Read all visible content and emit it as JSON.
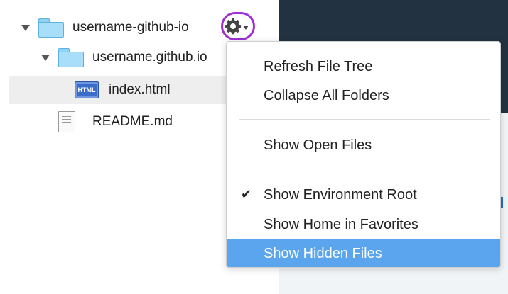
{
  "file_tree": {
    "root_folder": {
      "label": "username-github-io",
      "icon": "folder-icon"
    },
    "subfolder": {
      "label": "username.github.io",
      "icon": "folder-icon"
    },
    "files": [
      {
        "label": "index.html",
        "icon": "html-file-icon",
        "badge": "HTML",
        "selected": true
      },
      {
        "label": "README.md",
        "icon": "document-icon",
        "selected": false
      }
    ]
  },
  "toolbar": {
    "gear_icon": "gear-icon",
    "caret_icon": "chevron-down-icon"
  },
  "context_menu": {
    "items": [
      {
        "label": "Refresh File Tree"
      },
      {
        "label": "Collapse All Folders"
      },
      {
        "label": "Show Open Files"
      },
      {
        "label": "Show Environment Root",
        "checked": true
      },
      {
        "label": "Show Home in Favorites"
      },
      {
        "label": "Show Hidden Files",
        "highlighted": true
      }
    ],
    "check_glyph": "✔"
  },
  "colors": {
    "highlight": "#5aa5ee",
    "gear_ring": "#a12fd3",
    "dark_pane": "#233241",
    "folder": "#a9defa"
  }
}
